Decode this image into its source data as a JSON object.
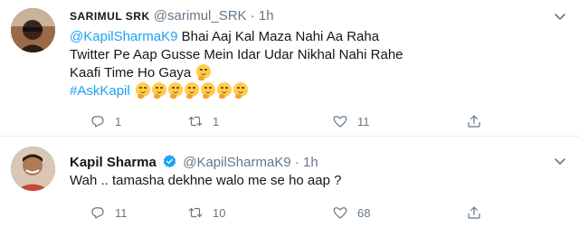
{
  "tweets": [
    {
      "author_name": "SARIMUL SRK",
      "handle": "@sarimul_SRK",
      "separator": "·",
      "time": "1h",
      "verified": false,
      "text": {
        "mention": "@KapilSharmaK9",
        "line1_rest": "  Bhai Aaj Kal Maza Nahi Aa Raha",
        "line2": "Twitter Pe Aap Gusse Mein Idar Udar Nikhal Nahi Rahe",
        "line3": "Kaafi Time Ho Gaya",
        "line3_emoji": "🤭",
        "hashtag": "#AskKapil",
        "emoji_run": [
          "🤭",
          "🤭",
          "🤭",
          "🤭",
          "🤭",
          "🤭",
          "🤭"
        ]
      },
      "reply_count": "1",
      "retweet_count": "1",
      "like_count": "11"
    },
    {
      "author_name": "Kapil Sharma",
      "handle": "@KapilSharmaK9",
      "separator": "·",
      "time": "1h",
      "verified": true,
      "text": {
        "line1": "Wah .. tamasha dekhne walo me se ho aap ?"
      },
      "reply_count": "11",
      "retweet_count": "10",
      "like_count": "68"
    }
  ],
  "colors": {
    "link": "#1da1f2",
    "muted": "#657786",
    "text": "#14171a",
    "verified": "#1da1f2",
    "divider": "#e6ecf0"
  },
  "icons": [
    "chevron-down-icon",
    "reply-icon",
    "retweet-icon",
    "like-icon",
    "share-icon",
    "verified-badge-icon",
    "face-with-hand-over-mouth-emoji"
  ]
}
